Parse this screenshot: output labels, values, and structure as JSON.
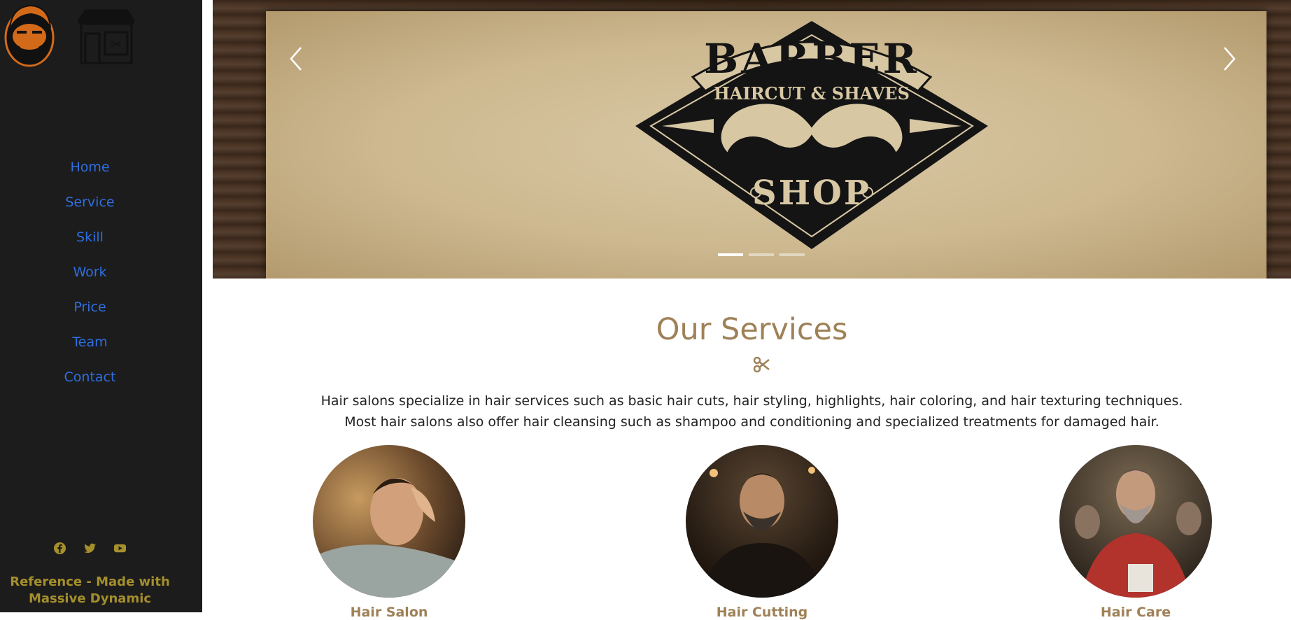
{
  "sidebar": {
    "nav": [
      {
        "label": "Home"
      },
      {
        "label": "Service"
      },
      {
        "label": "Skill"
      },
      {
        "label": "Work"
      },
      {
        "label": "Price"
      },
      {
        "label": "Team"
      },
      {
        "label": "Contact"
      }
    ],
    "socials": [
      "facebook-icon",
      "twitter-icon",
      "youtube-icon"
    ],
    "credit_line1": "Reference - Made with",
    "credit_line2": "Massive Dynamic",
    "colors": {
      "background": "#1c1c1c",
      "link": "#2f6fe0",
      "credit": "#a58f2c"
    }
  },
  "hero": {
    "logo": {
      "word_top": "BARBER",
      "tagline": "HAIRCUT & SHAVES",
      "word_bottom": "SHOP"
    },
    "prev_icon": "chevron-left-icon",
    "next_icon": "chevron-right-icon",
    "slides_count": 3,
    "active_slide": 1
  },
  "services": {
    "title": "Our Services",
    "divider_icon": "scissors-icon",
    "description_line1": "Hair salons specialize in hair services such as basic hair cuts, hair styling, highlights, hair coloring, and hair texturing techniques.",
    "description_line2": "Most hair salons also offer hair cleansing such as shampoo and conditioning and specialized treatments for damaged hair.",
    "items": [
      {
        "name": "Hair Salon"
      },
      {
        "name": "Hair Cutting"
      },
      {
        "name": "Hair Care"
      }
    ],
    "colors": {
      "title": "#9f8157"
    }
  }
}
